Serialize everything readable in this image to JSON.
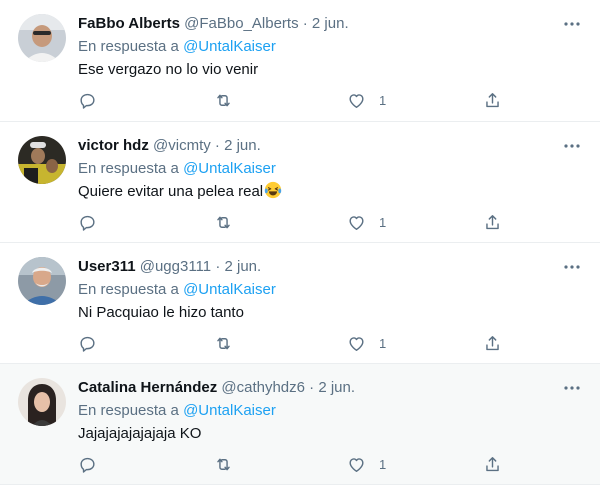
{
  "reply_prefix": "En respuesta a",
  "tweets": [
    {
      "name": "FaBbo Alberts",
      "handle": "@FaBbo_Alberts",
      "separator": "·",
      "date": "2 jun.",
      "reply_to": "@UntalKaiser",
      "text": "Ese vergazo no lo vio venir",
      "reply_count": "",
      "retweet_count": "",
      "like_count": "1"
    },
    {
      "name": "victor hdz",
      "handle": "@vicmty",
      "separator": "·",
      "date": "2 jun.",
      "reply_to": "@UntalKaiser",
      "text": "Quiere evitar una pelea real",
      "emoji": "laughing-tears-emoji",
      "reply_count": "",
      "retweet_count": "",
      "like_count": "1"
    },
    {
      "name": "User311",
      "handle": "@ugg3111",
      "separator": "·",
      "date": "2 jun.",
      "reply_to": "@UntalKaiser",
      "text": "Ni Pacquiao le hizo tanto",
      "reply_count": "",
      "retweet_count": "",
      "like_count": "1"
    },
    {
      "name": "Catalina Hernández",
      "handle": "@cathyhdz6",
      "separator": "·",
      "date": "2 jun.",
      "reply_to": "@UntalKaiser",
      "text": "Jajajajajajajaja KO",
      "reply_count": "",
      "retweet_count": "",
      "like_count": "1"
    }
  ],
  "colors": {
    "text_primary": "#0f1419",
    "text_secondary": "#5b7083",
    "link": "#1da1f2",
    "divider": "#ebeef0",
    "hover_bg": "#f7f9f9"
  },
  "icons": {
    "reply": "reply-icon",
    "retweet": "retweet-icon",
    "like": "heart-icon",
    "share": "share-icon",
    "more": "more-icon"
  }
}
